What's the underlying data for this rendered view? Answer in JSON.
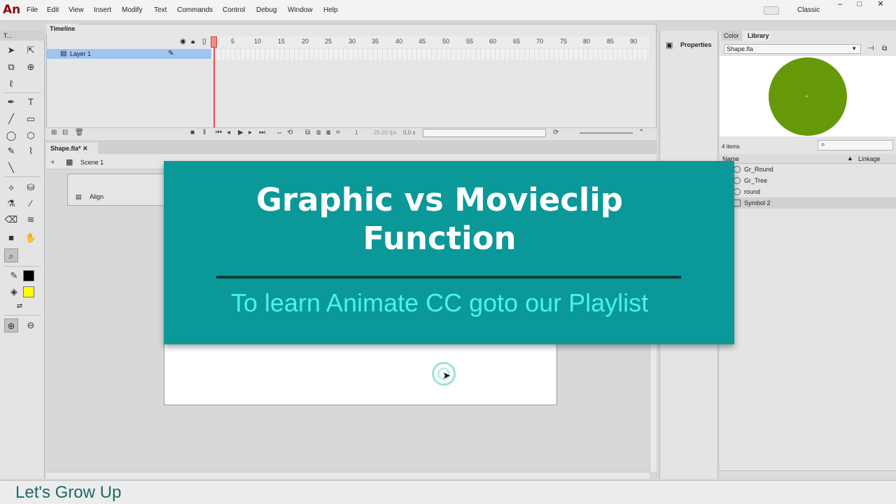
{
  "app": {
    "logo": "An"
  },
  "menu": [
    "File",
    "Edit",
    "View",
    "Insert",
    "Modify",
    "Text",
    "Commands",
    "Control",
    "Debug",
    "Window",
    "Help"
  ],
  "workspace": "Classic",
  "window_buttons": {
    "minimize": "–",
    "maximize": "□",
    "close": "✕"
  },
  "tools_tab": "T...",
  "timeline": {
    "tab": "Timeline",
    "ticks": [
      "1",
      "5",
      "10",
      "15",
      "20",
      "25",
      "30",
      "35",
      "40",
      "45",
      "50",
      "55",
      "60",
      "65",
      "70",
      "75",
      "80",
      "85",
      "90"
    ],
    "layer": "Layer 1",
    "frame": "1",
    "fps": "25.00 fps",
    "time": "0.0 s"
  },
  "document": {
    "tab": "Shape.fla*",
    "scene": "Scene 1",
    "align_label": "Align"
  },
  "properties": {
    "label": "Properties"
  },
  "library": {
    "tab_color": "Color",
    "tab_library": "Library",
    "doc": "Shape.fla",
    "count": "4 items",
    "col_name": "Name",
    "col_linkage": "Linkage",
    "items": [
      "Gr_Round",
      "Gr_Tree",
      "round",
      "Symbol 2"
    ],
    "preview_color": "#66990a"
  },
  "banner": {
    "title_line1": "Graphic vs Movieclip",
    "title_line2": "Function",
    "subtitle": "To learn Animate CC goto our Playlist",
    "bg_color": "#0b9898",
    "subtitle_color": "#48f2f0"
  },
  "brand": "Let's Grow Up",
  "colors": {
    "stroke": "#000000",
    "fill": "#ffff00"
  }
}
